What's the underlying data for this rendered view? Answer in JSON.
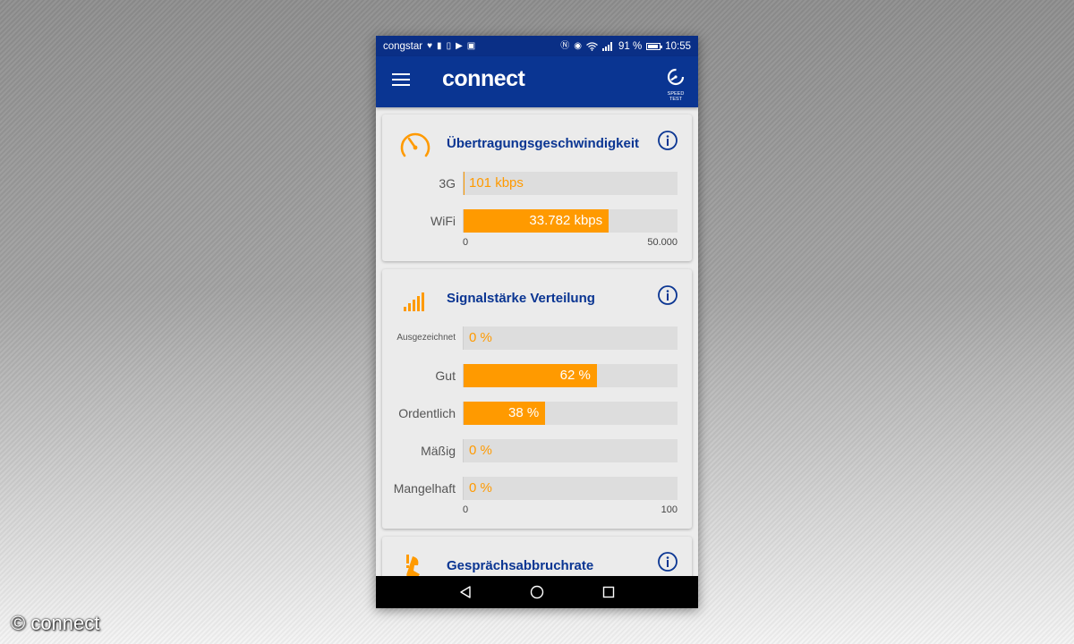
{
  "status_bar": {
    "carrier": "congstar",
    "battery_percent": "91 %",
    "battery_level": 0.91,
    "time": "10:55"
  },
  "app_bar": {
    "logo": "connect",
    "speedtest_label": [
      "SPEED",
      "TEST"
    ]
  },
  "cards": {
    "speed": {
      "title": "Übertragungsgeschwindigkeit",
      "bars": [
        {
          "label": "3G",
          "value_text": "101 kbps",
          "value": 101
        },
        {
          "label": "WiFi",
          "value_text": "33.782 kbps",
          "value": 33782
        }
      ],
      "scale_min": "0",
      "scale_max": "50.000",
      "max": 50000
    },
    "signal": {
      "title": "Signalstärke Verteilung",
      "bars": [
        {
          "label": "Ausgezeichnet",
          "value_text": "0 %",
          "value": 0
        },
        {
          "label": "Gut",
          "value_text": "62 %",
          "value": 62
        },
        {
          "label": "Ordentlich",
          "value_text": "38 %",
          "value": 38
        },
        {
          "label": "Mäßig",
          "value_text": "0 %",
          "value": 0
        },
        {
          "label": "Mangelhaft",
          "value_text": "0 %",
          "value": 0
        }
      ],
      "scale_min": "0",
      "scale_max": "100",
      "max": 100
    },
    "drop": {
      "title": "Gesprächsabbruchrate"
    }
  },
  "watermark": "© connect",
  "colors": {
    "primary": "#0a3592",
    "status_bar": "#0a2f86",
    "accent": "#ff9a00",
    "track": "#dddddd"
  },
  "icons": [
    "menu-icon",
    "speedtest-icon",
    "speedometer-icon",
    "info-icon",
    "signal-bars-icon",
    "call-drop-icon",
    "back-icon",
    "home-icon",
    "recents-icon"
  ]
}
